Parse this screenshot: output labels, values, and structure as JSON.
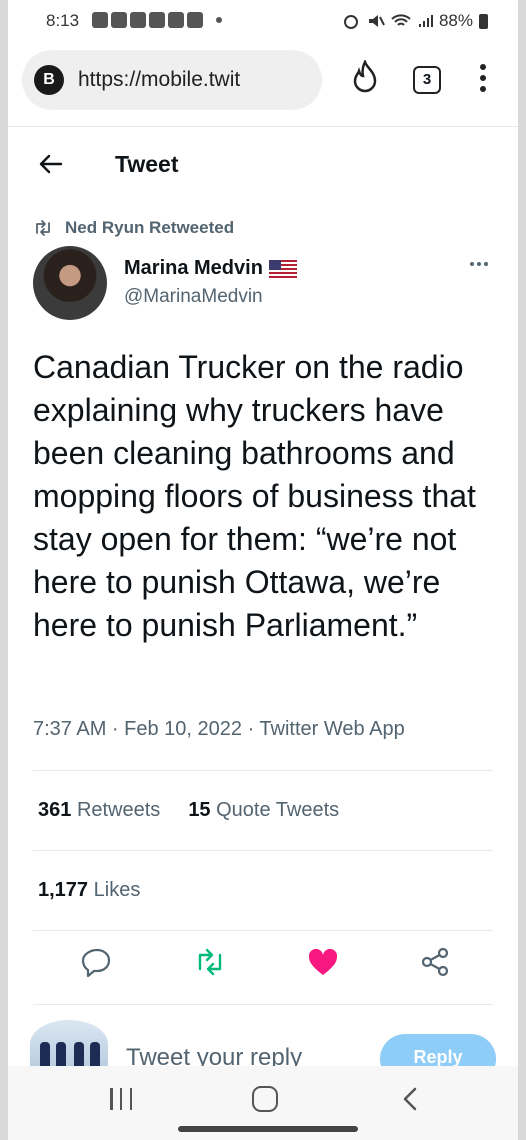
{
  "status_bar": {
    "time": "8:13",
    "battery": "88%"
  },
  "browser": {
    "site_badge": "B",
    "url": "https://mobile.twit",
    "tab_count": "3"
  },
  "header": {
    "title": "Tweet"
  },
  "retweet_context": {
    "label": "Ned Ryun Retweeted"
  },
  "tweet": {
    "author_name": "Marina Medvin",
    "author_handle": "@MarinaMedvin",
    "text": "Canadian Trucker on the radio explaining why truckers have been cleaning bathrooms and mopping floors of business that stay open for them: “we’re not here to punish Ottawa, we’re here to punish Parliament.”",
    "meta": "7:37 AM · Feb 10, 2022 · Twitter Web App",
    "retweets_count": "361",
    "retweets_label": "Retweets",
    "quote_count": "15",
    "quote_label": "Quote Tweets",
    "likes_count": "1,177",
    "likes_label": "Likes"
  },
  "reply": {
    "placeholder": "Tweet your reply",
    "button_label": "Reply"
  },
  "colors": {
    "retweet_green": "#00ba7c",
    "like_pink": "#f91880",
    "icon_grey": "#536471",
    "reply_button": "#8ecdf7"
  }
}
